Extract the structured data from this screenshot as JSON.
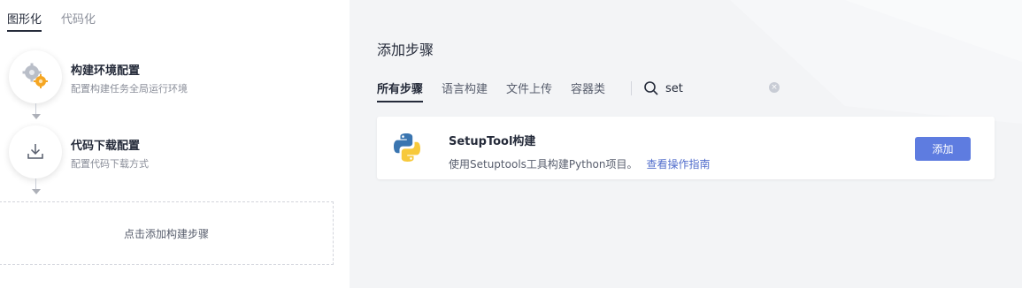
{
  "mode_tabs": [
    {
      "label": "图形化",
      "active": true
    },
    {
      "label": "代码化",
      "active": false
    }
  ],
  "steps": [
    {
      "title": "构建环境配置",
      "desc": "配置构建任务全局运行环境",
      "icon": "gears-icon"
    },
    {
      "title": "代码下载配置",
      "desc": "配置代码下载方式",
      "icon": "download-icon"
    }
  ],
  "add_step_placeholder": "点击添加构建步骤",
  "panel": {
    "title": "添加步骤",
    "categories": [
      {
        "label": "所有步骤",
        "active": true
      },
      {
        "label": "语言构建",
        "active": false
      },
      {
        "label": "文件上传",
        "active": false
      },
      {
        "label": "容器类",
        "active": false
      }
    ],
    "search": {
      "value": "set",
      "placeholder": ""
    }
  },
  "results": [
    {
      "title": "SetupTool构建",
      "desc": "使用Setuptools工具构建Python项目。",
      "link": "查看操作指南",
      "button": "添加",
      "icon": "python-logo-icon"
    }
  ],
  "colors": {
    "primary": "#5e7ce0",
    "link": "#526ecc",
    "panel_bg": "#f3f4f6",
    "text": "#252b3a",
    "muted": "#8a8e99"
  }
}
